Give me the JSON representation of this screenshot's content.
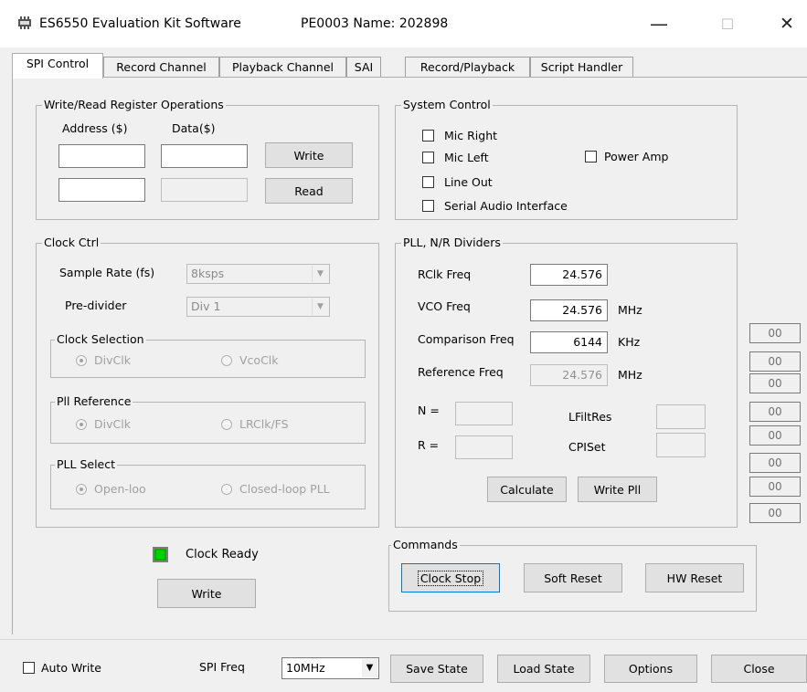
{
  "window": {
    "title": "ES6550 Evaluation Kit Software",
    "subtitle": "PE0003 Name: 202898",
    "icon": "app-chip-icon",
    "controls": {
      "minimize": "—",
      "maximize": "☐",
      "close": "✕"
    }
  },
  "tabs": [
    {
      "label": "SPI Control",
      "active": true
    },
    {
      "label": "Record Channel"
    },
    {
      "label": "Playback Channel"
    },
    {
      "label": "SAI"
    },
    {
      "label": "Record/Playback"
    },
    {
      "label": "Script Handler"
    }
  ],
  "write_read": {
    "title": "Write/Read Register Operations",
    "address_label": "Address ($)",
    "data_label": "Data($)",
    "write_button": "Write",
    "read_button": "Read",
    "address1": "",
    "data1": "",
    "address2": "",
    "data2": ""
  },
  "system_control": {
    "title": "System Control",
    "mic_right": "Mic Right",
    "mic_left": "Mic Left",
    "line_out": "Line Out",
    "serial_audio": "Serial Audio Interface",
    "power_amp": "Power Amp"
  },
  "clock_ctrl": {
    "title": "Clock Ctrl",
    "sample_rate_label": "Sample Rate (fs)",
    "sample_rate_value": "8ksps",
    "predivider_label": "Pre-divider",
    "predivider_value": "Div 1",
    "clock_selection": {
      "title": "Clock Selection",
      "opt1": "DivClk",
      "opt2": "VcoClk"
    },
    "pll_reference": {
      "title": "Pll Reference",
      "opt1": "DivClk",
      "opt2": "LRClk/FS"
    },
    "pll_select": {
      "title": "PLL Select",
      "opt1": "Open-loop",
      "opt2": "Closed-loop PLL"
    }
  },
  "pll": {
    "title": "PLL, N/R Dividers",
    "rclk_label": "RClk Freq",
    "rclk_value": "24.576",
    "vco_label": "VCO Freq",
    "vco_value": "24.576",
    "vco_unit": "MHz",
    "comparison_label": "Comparison Freq",
    "comparison_value": "6144",
    "comparison_unit": "KHz",
    "reference_label": "Reference Freq",
    "reference_value": "24.576",
    "reference_unit": "MHz",
    "n_label": "N =",
    "r_label": "R =",
    "lfiltres_label": "LFiltRes",
    "cpiset_label": "CPISet",
    "calculate_button": "Calculate",
    "write_pll_button": "Write Pll"
  },
  "side_values": [
    "00",
    "00",
    "00",
    "00",
    "00",
    "00",
    "00",
    "00"
  ],
  "clock_ready": {
    "label": "Clock Ready",
    "write_button": "Write",
    "led_color": "#00c000"
  },
  "commands": {
    "title": "Commands",
    "clock_stop": "Clock Stop",
    "soft_reset": "Soft Reset",
    "hw_reset": "HW Reset"
  },
  "footer": {
    "auto_write": "Auto Write",
    "spi_freq_label": "SPI Freq",
    "spi_freq_value": "10MHz",
    "save_state": "Save State",
    "load_state": "Load State",
    "options": "Options",
    "close": "Close"
  }
}
